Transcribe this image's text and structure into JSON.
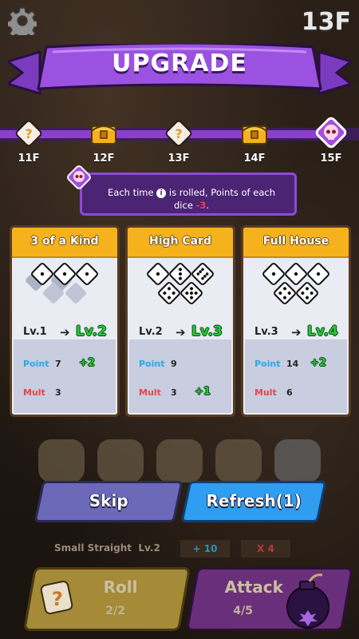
{
  "floor": "13F",
  "banner": {
    "title": "UPGRADE"
  },
  "progress": {
    "nodes": [
      {
        "label": "11F",
        "icon": "mystery-dice-icon"
      },
      {
        "label": "12F",
        "icon": "treasure-chest-icon"
      },
      {
        "label": "13F",
        "icon": "mystery-dice-icon"
      },
      {
        "label": "14F",
        "icon": "treasure-chest-icon"
      },
      {
        "label": "15F",
        "icon": "skull-icon"
      }
    ]
  },
  "tooltip": {
    "part1": "Each time",
    "part2": "is rolled, Points of each",
    "part3": "dice",
    "value": "-3",
    "part4": "."
  },
  "cards": [
    {
      "title": "3 of a Kind",
      "level_old": "Lv.1",
      "level_new": "Lv.2",
      "point_label": "Point",
      "point": "7",
      "point_bonus": "+2",
      "mult_label": "Mult",
      "mult": "3",
      "mult_bonus": ""
    },
    {
      "title": "High Card",
      "level_old": "Lv.2",
      "level_new": "Lv.3",
      "point_label": "Point",
      "point": "9",
      "point_bonus": "",
      "mult_label": "Mult",
      "mult": "3",
      "mult_bonus": "+1"
    },
    {
      "title": "Full House",
      "level_old": "Lv.3",
      "level_new": "Lv.4",
      "point_label": "Point",
      "point": "14",
      "point_bonus": "+2",
      "mult_label": "Mult",
      "mult": "6",
      "mult_bonus": ""
    }
  ],
  "buttons": {
    "skip": "Skip",
    "refresh": "Refresh(1)"
  },
  "hand": {
    "name": "Small Straight",
    "level": "Lv.2",
    "points": "+ 10",
    "mult": "X 4"
  },
  "roll": {
    "label": "Roll",
    "count": "2/2"
  },
  "attack": {
    "label": "Attack",
    "count": "4/5"
  },
  "colors": {
    "accent": "#8a3fcf",
    "card_head": "#f5b21d",
    "level_up": "#29c53a",
    "point": "#2aa8e8",
    "mult": "#e84545"
  }
}
